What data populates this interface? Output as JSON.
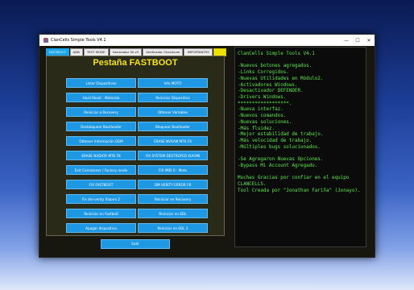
{
  "window": {
    "title": "ClanCells Simple Tools V4.1",
    "controls": {
      "minimize": "—",
      "maximize": "☐",
      "close": "✕"
    }
  },
  "tabs": [
    "FASTBOOT",
    "ADB",
    "TEST MODE",
    "Generador FA v3",
    "Verificador Checksum",
    "IMPORTANTES",
    ""
  ],
  "panel": {
    "title": "Pestaña FASTBOOT",
    "buttons_left": [
      "Listar Dispositivos",
      "Hard Reset - Motorola",
      "Reiniciar a Recovery",
      "Desbloquear Bootloader",
      "Obtener Información OEM",
      "ERASE NVDATA MTK F8",
      "Exit Comisioner / Factory mode",
      "FIX FASTBOOT",
      "Fix dm-verity Xiaomi 2",
      "Reiniciar en Fastbotl",
      "Apagar dispositivo"
    ],
    "buttons_right": [
      "Info MOTO",
      "Reiniciar Dispositivo",
      "Obtener Variables",
      "Bloquear Bootloader",
      "ERASE NVSAM MTK F8",
      "FIX SYSTEM DESTROYED XIAOMI",
      "FIX IMEI 0 - Moto",
      "DM VERITY ERROR F8",
      "Reiniciar en Recovery",
      "Reiniciar en EDL",
      "Reiniciar en EDL 2"
    ],
    "exit_label": "Salir"
  },
  "log": {
    "lines": [
      "ClanCells Simple Tools V4.1",
      "",
      "-Nuevos botones agregados.",
      "-Links Corregidos.",
      "-Nuevas Utilidades en Módulo2.",
      "-Activadores Windows.",
      "-Desactivador DEFENDER.",
      "-Drivers Windows.",
      "******************.",
      "-Nueva interfaz.",
      "-Nuevos comandos.",
      "-Nuevas soluciones.",
      "-Más fluidez.",
      "-Mejor estabilidad de trabajo.",
      "-Más velocidad de trabajo.",
      "-Múltiples bugs solucionados.",
      "",
      "-Se Agregaron Nuevas Opciones.",
      "-Bypass Mi Account Agregado.",
      "",
      "Muchas Gracias por confiar en el equipo",
      "CLANCELLS.",
      "Tool Creada por \"Jonathan Fariña\" (Jonayo)."
    ]
  },
  "colors": {
    "button_bg": "#1e98e3",
    "panel_title": "#f4e319",
    "log_text": "#5ee84b",
    "active_tab": "#1aa6e8",
    "yellow_tab": "#f2e200"
  }
}
